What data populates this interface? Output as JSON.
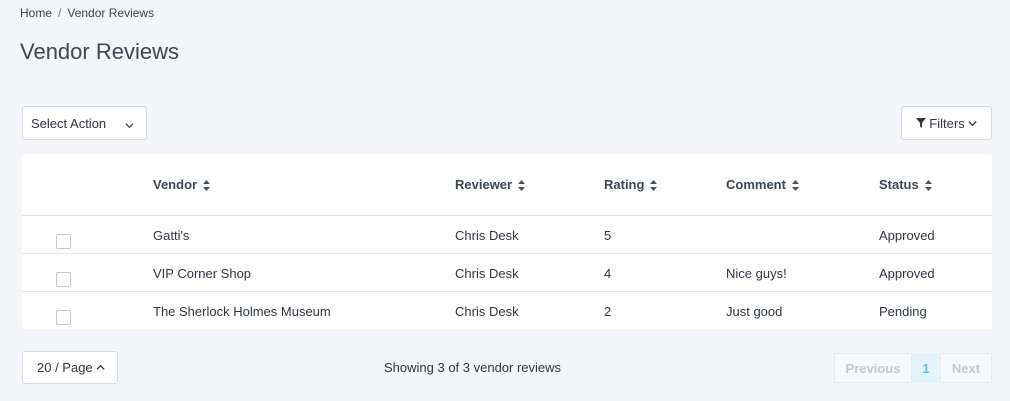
{
  "breadcrumb": {
    "home": "Home",
    "separator": "/",
    "current": "Vendor Reviews"
  },
  "page_title": "Vendor Reviews",
  "toolbar": {
    "select_action": "Select Action",
    "filters": "Filters",
    "filter_icon": "funnel-icon",
    "chevron_icon": "chevron-down-icon"
  },
  "table": {
    "columns": [
      "Vendor",
      "Reviewer",
      "Rating",
      "Comment",
      "Status"
    ],
    "sort_icon": "sort-icon",
    "rows": [
      {
        "vendor": "Gatti's",
        "reviewer": "Chris Desk",
        "rating": "5",
        "comment": "",
        "status": "Approved"
      },
      {
        "vendor": "VIP Corner Shop",
        "reviewer": "Chris Desk",
        "rating": "4",
        "comment": "Nice guys!",
        "status": "Approved"
      },
      {
        "vendor": "The Sherlock Holmes Museum",
        "reviewer": "Chris Desk",
        "rating": "2",
        "comment": "Just good",
        "status": "Pending"
      }
    ]
  },
  "footer": {
    "per_page": "20 / Page",
    "showing": "Showing 3 of 3 vendor reviews",
    "pagination": {
      "previous": "Previous",
      "current": "1",
      "next": "Next"
    }
  },
  "colors": {
    "background": "#f3f5f8",
    "active_page": "#5ec1e0",
    "active_page_bg": "#e4f4fa"
  }
}
